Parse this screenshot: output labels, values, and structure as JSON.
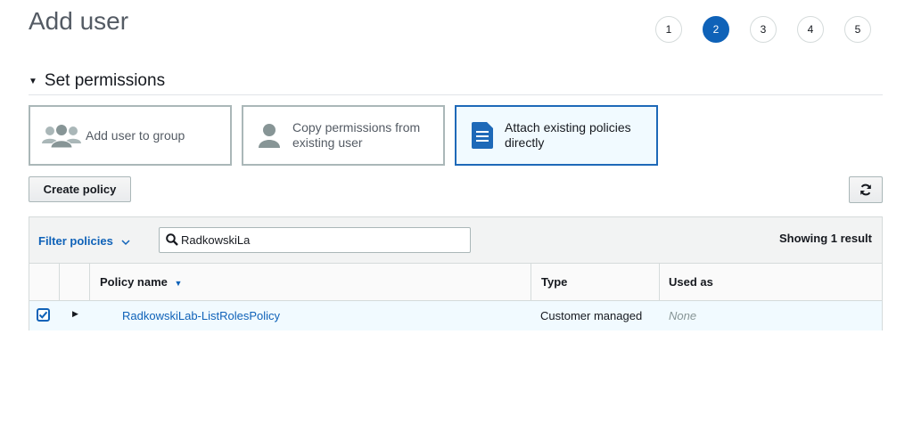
{
  "page": {
    "title": "Add user"
  },
  "steps": [
    "1",
    "2",
    "3",
    "4",
    "5"
  ],
  "active_step": "2",
  "section": {
    "title": "Set permissions"
  },
  "options": {
    "add_to_group": "Add user to group",
    "copy_permissions": "Copy permissions from existing user",
    "attach_policies": "Attach existing policies directly",
    "selected": "attach_policies"
  },
  "toolbar": {
    "create_policy_label": "Create policy"
  },
  "filter": {
    "label": "Filter policies",
    "search_value": "RadkowskiLa",
    "result_count": "Showing 1 result"
  },
  "table": {
    "columns": {
      "policy_name": "Policy name",
      "type": "Type",
      "used_as": "Used as"
    },
    "rows": [
      {
        "checked": true,
        "policy_name": "RadkowskiLab-ListRolesPolicy",
        "type": "Customer managed",
        "used_as": "None"
      }
    ]
  },
  "colors": {
    "accent": "#0f62b8",
    "selected_bg": "#f1faff",
    "border": "#aab7b8"
  }
}
